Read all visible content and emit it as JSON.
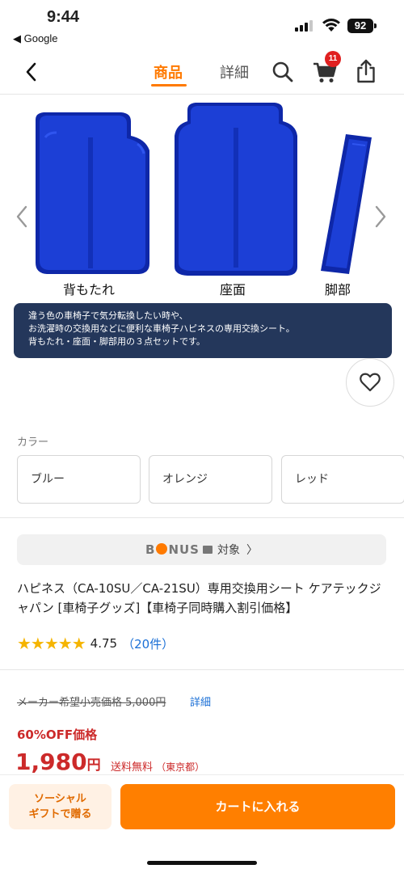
{
  "status_bar": {
    "time": "9:44",
    "back_app": "◀ Google",
    "battery": "92"
  },
  "nav": {
    "tabs": [
      {
        "label": "商品",
        "active": true
      },
      {
        "label": "詳細",
        "active": false
      }
    ],
    "cart_count": "11",
    "accent_color": "#ff7a00"
  },
  "product_image": {
    "captions": [
      "背もたれ",
      "座面",
      "脚部"
    ],
    "info_lines": [
      "違う色の車椅子で気分転換したい時や、",
      "お洗濯時の交換用などに便利な車椅子ハピネスの専用交換シート。",
      "背もたれ・座面・脚部用の３点セットです。"
    ],
    "cushion_color": "#1c3fd6"
  },
  "color_section": {
    "label": "カラー",
    "options": [
      "ブルー",
      "オレンジ",
      "レッド"
    ]
  },
  "bonus": {
    "logo_prefix": "B",
    "logo_suffix": "NUS",
    "target_label": "対象",
    "chevron": "〉"
  },
  "product": {
    "title": "ハピネス（CA-10SU／CA-21SU）専用交換用シート ケアテックジャパン [車椅子グッズ]【車椅子同時購入割引価格】",
    "stars": "★★★★★",
    "rating": "4.75",
    "review_count": "（20件）"
  },
  "pricing": {
    "list_price": "メーカー希望小売価格 5,000円",
    "detail_link": "詳細",
    "discount_label": "60%OFF価格",
    "sale_price": "1,980",
    "currency": "円",
    "shipping": "送料無料",
    "shipping_region": "（東京都）",
    "price_color": "#cc2a2a"
  },
  "bottom_bar": {
    "gift_line1": "ソーシャル",
    "gift_line2": "ギフトで贈る",
    "cart_button": "カートに入れる"
  }
}
